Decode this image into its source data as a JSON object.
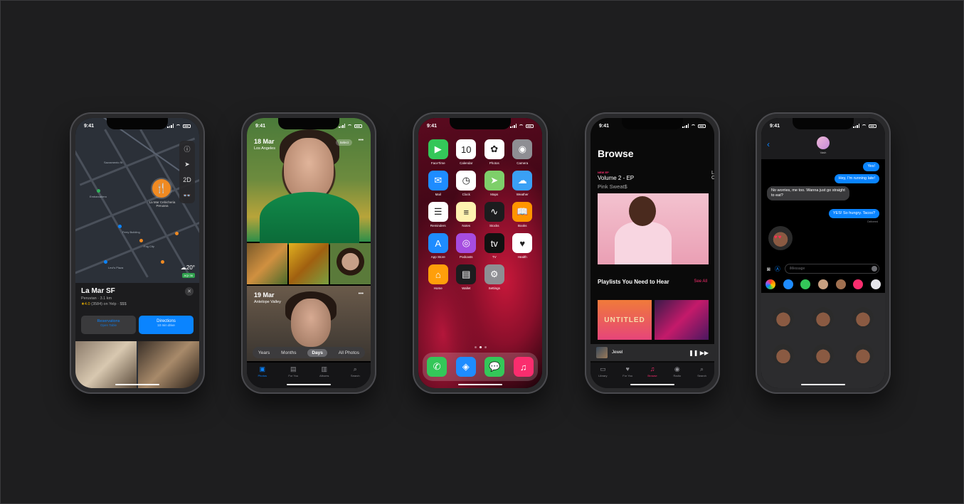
{
  "status_time": "9:41",
  "maps": {
    "controls": [
      "ⓘ",
      "➤",
      "2D",
      "👓"
    ],
    "pin_label": "La Mar Cebicheria Peruana",
    "poi_labels": [
      "Embarcadero",
      "Sacramento St",
      "Ferry Building",
      "Fog City",
      "Levi's Plaza"
    ],
    "temperature": "☁20°",
    "aqi": "AQI 36",
    "place_title": "La Mar SF",
    "place_sub": "Peruvian · 3.1 km",
    "rating_star": "★4.0",
    "rating_rest": "(3584) on Yelp · $$$",
    "reservations_label": "Reservations",
    "reservations_sub": "Open Table",
    "directions_label": "Directions",
    "directions_sub": "10 min drive"
  },
  "photos": {
    "date1": "18 Mar",
    "loc1": "Los Angeles",
    "select_label": "Select",
    "more": "•••",
    "date2": "19 Mar",
    "loc2": "Antelope Valley",
    "segments": [
      "Years",
      "Months",
      "Days",
      "All Photos"
    ],
    "tabs": [
      "Photos",
      "For You",
      "Albums",
      "Search"
    ]
  },
  "home": {
    "apps": [
      {
        "label": "FaceTime",
        "glyph": "▶",
        "color": "#34c759"
      },
      {
        "label": "Calendar",
        "glyph": "10",
        "color": "#ffffff"
      },
      {
        "label": "Photos",
        "glyph": "✿",
        "color": "#ffffff"
      },
      {
        "label": "Camera",
        "glyph": "◉",
        "color": "#8e8e93"
      },
      {
        "label": "Mail",
        "glyph": "✉",
        "color": "#1e8cff"
      },
      {
        "label": "Clock",
        "glyph": "◷",
        "color": "#ffffff"
      },
      {
        "label": "Maps",
        "glyph": "➤",
        "color": "#7ecf6a"
      },
      {
        "label": "Weather",
        "glyph": "☁",
        "color": "#3aa0f5"
      },
      {
        "label": "Reminders",
        "glyph": "☰",
        "color": "#ffffff"
      },
      {
        "label": "Notes",
        "glyph": "≡",
        "color": "#fff2b0"
      },
      {
        "label": "Stocks",
        "glyph": "∿",
        "color": "#1c1c1e"
      },
      {
        "label": "Books",
        "glyph": "📖",
        "color": "#ff9500"
      },
      {
        "label": "App Store",
        "glyph": "A",
        "color": "#1e8cff"
      },
      {
        "label": "Podcasts",
        "glyph": "◎",
        "color": "#a64ce0"
      },
      {
        "label": "TV",
        "glyph": "tv",
        "color": "#111111"
      },
      {
        "label": "Health",
        "glyph": "♥",
        "color": "#ffffff"
      },
      {
        "label": "Home",
        "glyph": "⌂",
        "color": "#ff9f0a"
      },
      {
        "label": "Wallet",
        "glyph": "▤",
        "color": "#1c1c1e"
      },
      {
        "label": "Settings",
        "glyph": "⚙",
        "color": "#8e8e93"
      }
    ],
    "dock": [
      {
        "glyph": "✆",
        "color": "#34c759"
      },
      {
        "glyph": "◈",
        "color": "#1e8cff"
      },
      {
        "glyph": "💬",
        "color": "#34c759"
      },
      {
        "glyph": "♫",
        "color": "#fa2d6e"
      }
    ]
  },
  "music": {
    "title": "Browse",
    "new_ep": "NEW EP",
    "album": "Volume 2 - EP",
    "artist": "Pink Sweat$",
    "section": "Playlists You Need to Hear",
    "see_all": "See All",
    "tile1": "UNTITLED",
    "now_playing": "Jewel",
    "controls": "❚❚  ▶▶",
    "tabs": [
      "Library",
      "For You",
      "Browse",
      "Radio",
      "Search"
    ]
  },
  "messages": {
    "back": "‹",
    "contact": "Vash",
    "bubbles": [
      {
        "text": "Yes!",
        "side": "me"
      },
      {
        "text": "Hey, I'm running late!",
        "side": "me"
      },
      {
        "text": "No worries, me too. Wanna just go straight to eat?",
        "side": "them"
      },
      {
        "text": "YES! So hungry. Tacos?",
        "side": "me"
      }
    ],
    "delivered": "Delivered",
    "placeholder": "iMessage"
  }
}
